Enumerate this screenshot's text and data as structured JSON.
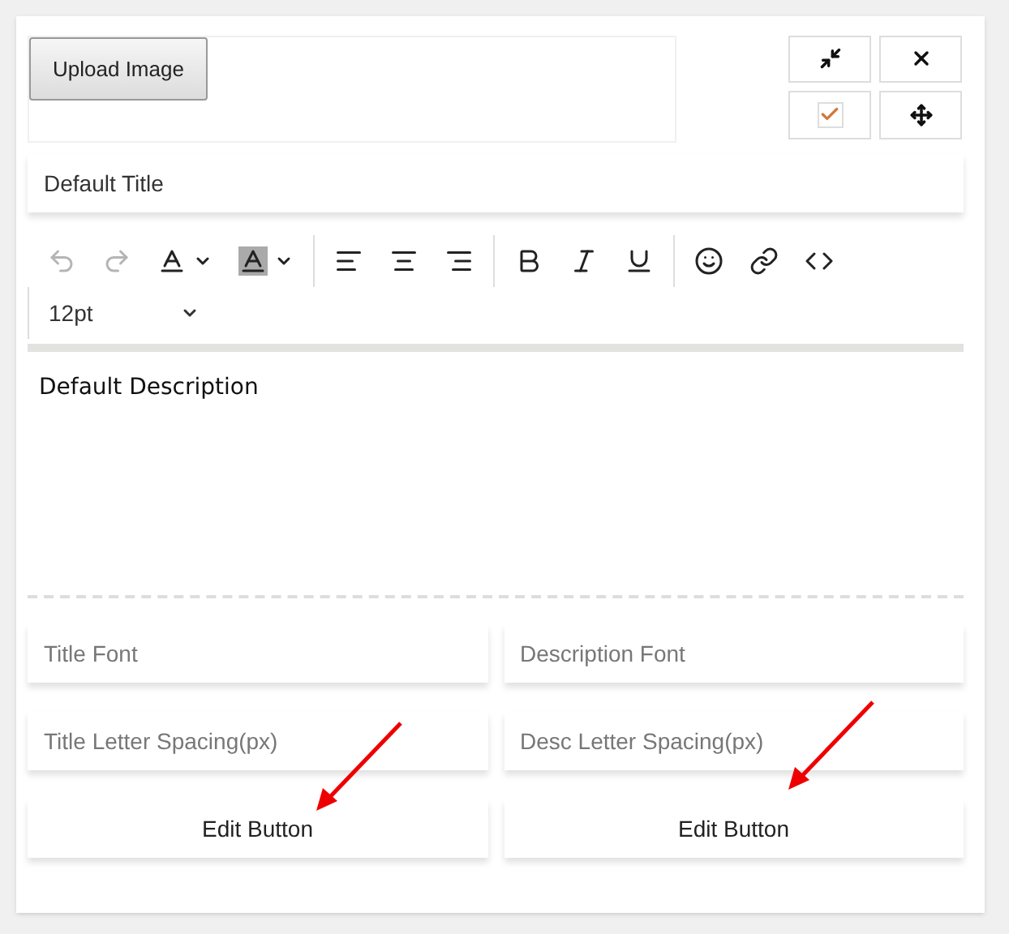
{
  "upload": {
    "label": "Upload Image"
  },
  "corner_controls": [
    {
      "kind": "collapse"
    },
    {
      "kind": "close"
    },
    {
      "kind": "checkbox",
      "checked": true
    },
    {
      "kind": "move"
    }
  ],
  "title_field": {
    "value": "Default Title"
  },
  "toolbar": {
    "groups": [
      [
        {
          "kind": "undo",
          "disabled": true
        },
        {
          "kind": "redo",
          "disabled": true
        },
        {
          "kind": "text-color",
          "disabled": false
        },
        {
          "kind": "background-color",
          "disabled": false
        }
      ],
      [
        {
          "kind": "align-left",
          "disabled": false
        },
        {
          "kind": "align-center",
          "disabled": false
        },
        {
          "kind": "align-right",
          "disabled": false
        }
      ],
      [
        {
          "kind": "bold",
          "disabled": false
        },
        {
          "kind": "italic",
          "disabled": false
        },
        {
          "kind": "underline",
          "disabled": false
        }
      ],
      [
        {
          "kind": "emoji",
          "disabled": false
        },
        {
          "kind": "link",
          "disabled": false
        },
        {
          "kind": "code",
          "disabled": false
        }
      ]
    ],
    "font_size": "12pt"
  },
  "description": "Default Description",
  "fields": [
    {
      "placeholder": "Title Font"
    },
    {
      "placeholder": "Description Font"
    },
    {
      "placeholder": "Title Letter Spacing(px)"
    },
    {
      "placeholder": "Desc Letter Spacing(px)"
    }
  ],
  "edit_buttons": [
    {
      "label": "Edit Button"
    },
    {
      "label": "Edit Button"
    }
  ]
}
